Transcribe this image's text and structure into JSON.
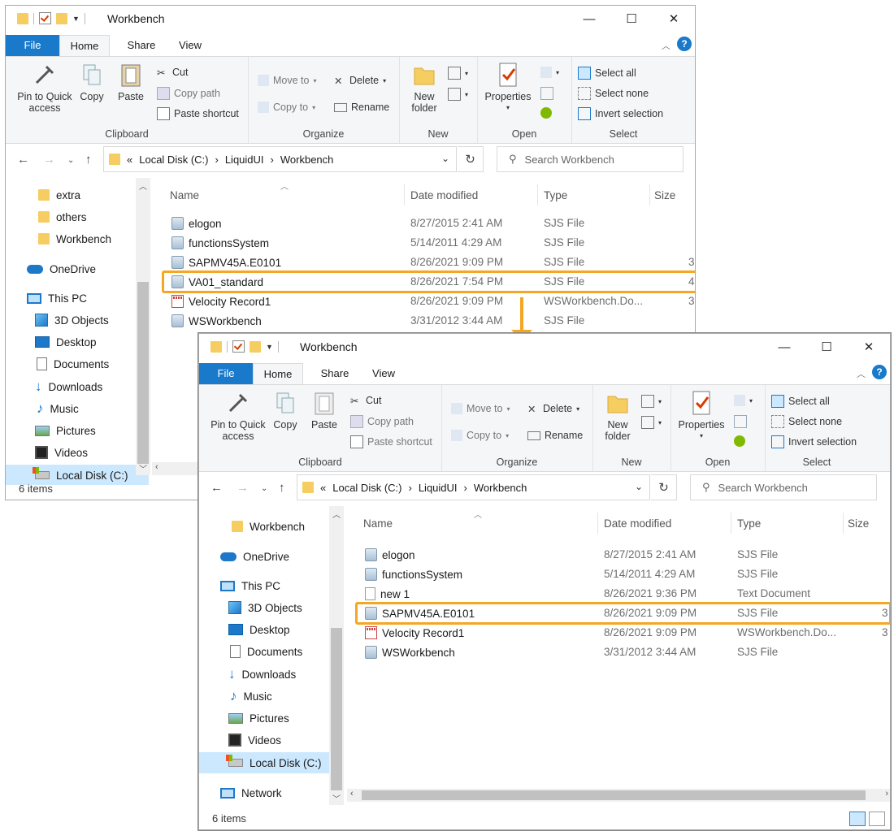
{
  "colors": {
    "accent": "#1979ca",
    "highlight": "#f5a623",
    "selected_nav": "#cce8ff"
  },
  "window_before": {
    "title": "Workbench",
    "tabs": {
      "file": "File",
      "home": "Home",
      "share": "Share",
      "view": "View"
    },
    "ribbon": {
      "pin": "Pin to Quick access",
      "copy": "Copy",
      "paste": "Paste",
      "cut": "Cut",
      "copy_path": "Copy path",
      "paste_shortcut": "Paste shortcut",
      "clipboard": "Clipboard",
      "move_to": "Move to",
      "copy_to": "Copy to",
      "delete": "Delete",
      "rename": "Rename",
      "organize": "Organize",
      "new_folder": "New folder",
      "new": "New",
      "properties": "Properties",
      "open": "Open",
      "select_all": "Select all",
      "select_none": "Select none",
      "invert_selection": "Invert selection",
      "select": "Select"
    },
    "address": {
      "overflow": "«",
      "crumbs": [
        "Local Disk (C:)",
        "LiquidUI",
        "Workbench"
      ]
    },
    "search_placeholder": "Search Workbench",
    "nav_items": [
      "extra",
      "others",
      "Workbench",
      "OneDrive",
      "This PC",
      "3D Objects",
      "Desktop",
      "Documents",
      "Downloads",
      "Music",
      "Pictures",
      "Videos",
      "Local Disk (C:)"
    ],
    "columns": {
      "name": "Name",
      "date": "Date modified",
      "type": "Type",
      "size": "Size"
    },
    "files": [
      {
        "name": "elogon",
        "date": "8/27/2015 2:41 AM",
        "type": "SJS File",
        "size": ""
      },
      {
        "name": "functionsSystem",
        "date": "5/14/2011 4:29 AM",
        "type": "SJS File",
        "size": ""
      },
      {
        "name": "SAPMV45A.E0101",
        "date": "8/26/2021 9:09 PM",
        "type": "SJS File",
        "size": "3"
      },
      {
        "name": "VA01_standard",
        "date": "8/26/2021 7:54 PM",
        "type": "SJS File",
        "size": "4"
      },
      {
        "name": "Velocity Record1",
        "date": "8/26/2021 9:09 PM",
        "type": "WSWorkbench.Do...",
        "size": "3"
      },
      {
        "name": "WSWorkbench",
        "date": "3/31/2012 3:44 AM",
        "type": "SJS File",
        "size": ""
      }
    ],
    "status": "6 items"
  },
  "window_after": {
    "title": "Workbench",
    "tabs": {
      "file": "File",
      "home": "Home",
      "share": "Share",
      "view": "View"
    },
    "ribbon": {
      "pin": "Pin to Quick access",
      "copy": "Copy",
      "paste": "Paste",
      "cut": "Cut",
      "copy_path": "Copy path",
      "paste_shortcut": "Paste shortcut",
      "clipboard": "Clipboard",
      "move_to": "Move to",
      "copy_to": "Copy to",
      "delete": "Delete",
      "rename": "Rename",
      "organize": "Organize",
      "new_folder": "New folder",
      "new": "New",
      "properties": "Properties",
      "open": "Open",
      "select_all": "Select all",
      "select_none": "Select none",
      "invert_selection": "Invert selection",
      "select": "Select"
    },
    "address": {
      "overflow": "«",
      "crumbs": [
        "Local Disk (C:)",
        "LiquidUI",
        "Workbench"
      ]
    },
    "search_placeholder": "Search Workbench",
    "nav_items": [
      "Workbench",
      "OneDrive",
      "This PC",
      "3D Objects",
      "Desktop",
      "Documents",
      "Downloads",
      "Music",
      "Pictures",
      "Videos",
      "Local Disk (C:)",
      "Network"
    ],
    "columns": {
      "name": "Name",
      "date": "Date modified",
      "type": "Type",
      "size": "Size"
    },
    "files": [
      {
        "name": "elogon",
        "date": "8/27/2015 2:41 AM",
        "type": "SJS File",
        "size": ""
      },
      {
        "name": "functionsSystem",
        "date": "5/14/2011 4:29 AM",
        "type": "SJS File",
        "size": ""
      },
      {
        "name": "new 1",
        "date": "8/26/2021 9:36 PM",
        "type": "Text Document",
        "size": ""
      },
      {
        "name": "SAPMV45A.E0101",
        "date": "8/26/2021 9:09 PM",
        "type": "SJS File",
        "size": "3"
      },
      {
        "name": "Velocity Record1",
        "date": "8/26/2021 9:09 PM",
        "type": "WSWorkbench.Do...",
        "size": "3"
      },
      {
        "name": "WSWorkbench",
        "date": "3/31/2012 3:44 AM",
        "type": "SJS File",
        "size": ""
      }
    ],
    "status": "6 items"
  }
}
